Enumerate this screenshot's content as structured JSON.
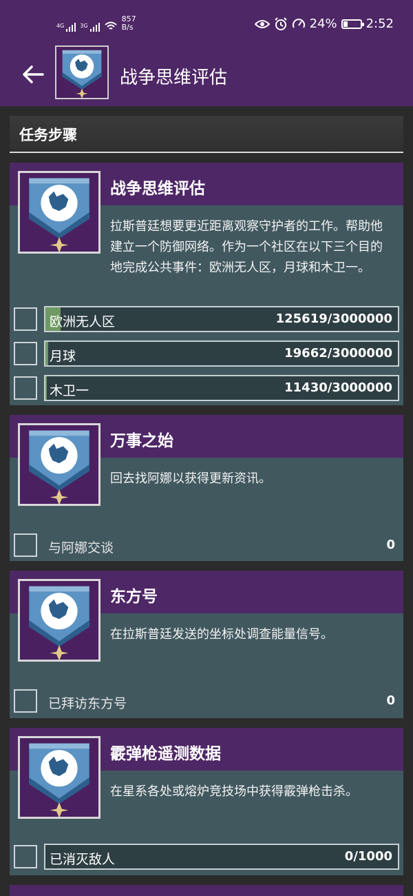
{
  "status": {
    "net1": "4G",
    "net2": "3G",
    "speed_value": "857",
    "speed_unit": "B/s",
    "battery": "24%",
    "time": "2:52"
  },
  "header": {
    "title": "战争思维评估"
  },
  "section": {
    "title": "任务步骤"
  },
  "quests": [
    {
      "title": "战争思维评估",
      "description": "拉斯普廷想要更近距离观察守护者的工作。帮助他建立一个防御网络。作为一个社区在以下三个目的地完成公共事件：欧洲无人区，月球和木卫一。",
      "objectives": [
        {
          "label": "欧洲无人区",
          "count": "125619/3000000",
          "progress": 0.042
        },
        {
          "label": "月球",
          "count": "19662/3000000",
          "progress": 0.007
        },
        {
          "label": "木卫一",
          "count": "11430/3000000",
          "progress": 0.004
        }
      ]
    },
    {
      "title": "万事之始",
      "description": "回去找阿娜以获得更新资讯。",
      "objectives": [
        {
          "label": "与阿娜交谈",
          "count": "0"
        }
      ]
    },
    {
      "title": "东方号",
      "description": "在拉斯普廷发送的坐标处调查能量信号。",
      "objectives": [
        {
          "label": "已拜访东方号",
          "count": "0"
        }
      ]
    },
    {
      "title": "霰弹枪遥测数据",
      "description": "在星系各处或熔炉竞技场中获得霰弹枪击杀。",
      "objectives": [
        {
          "label": "已消灭敌人 ",
          "count": "0/1000",
          "progress": 0
        }
      ]
    }
  ],
  "colors": {
    "purple": "#4e2766",
    "card": "#41585f",
    "progress": "#6f9a63"
  },
  "icons": [
    "back-arrow-icon",
    "wolf-banner-emblem-icon",
    "eye-icon",
    "alarm-icon",
    "speed-icon",
    "battery-icon",
    "wifi-icon",
    "signal-icon"
  ]
}
